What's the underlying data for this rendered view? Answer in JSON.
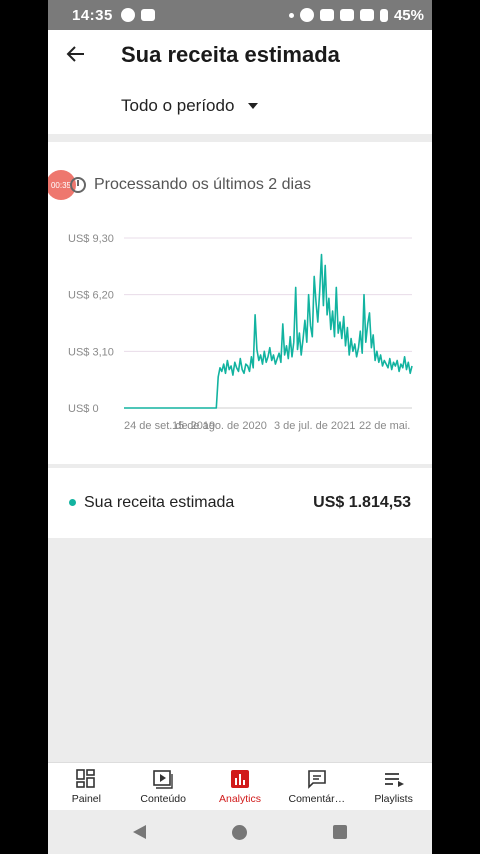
{
  "status_bar": {
    "time": "14:35",
    "battery": "45%",
    "icons": [
      "messenger-icon",
      "video-icon",
      "dot-icon",
      "vibrate-icon",
      "wifi-calling-icon",
      "wifi-icon",
      "signal-icon",
      "battery-icon"
    ]
  },
  "header": {
    "title": "Sua receita estimada",
    "period": "Todo o período"
  },
  "processing": {
    "text": "Processando os últimos 2 dias",
    "touch_indicator": "00:35"
  },
  "chart_data": {
    "type": "line",
    "y_ticks": [
      "US$ 9,30",
      "US$ 6,20",
      "US$ 3,10",
      "US$ 0"
    ],
    "ylim": [
      0,
      9.3
    ],
    "x_ticks": [
      "24 de set. de 2019",
      "15 de ago. de 2020",
      "3 de jul. de 2021",
      "22 de mai."
    ],
    "series": [
      {
        "name": "Sua receita estimada",
        "color": "#12b3a0",
        "values": [
          0,
          0,
          0,
          0,
          0,
          0,
          0,
          0,
          0,
          0,
          0,
          0,
          0,
          0,
          0,
          0,
          0,
          0,
          0,
          0,
          0,
          0,
          0,
          0,
          0,
          0,
          0,
          0,
          0,
          0,
          0,
          0,
          0,
          0,
          0,
          0,
          0,
          0,
          0,
          0,
          0,
          0,
          0,
          0,
          0,
          0,
          0,
          0,
          0,
          0,
          0,
          1.7,
          2.2,
          2.0,
          2.4,
          1.9,
          2.6,
          2.1,
          2.3,
          1.8,
          2.5,
          2.2,
          2.0,
          2.7,
          2.1,
          1.9,
          2.4,
          2.3,
          2.0,
          2.8,
          2.2,
          5.1,
          3.2,
          2.6,
          2.9,
          2.4,
          3.1,
          2.5,
          2.8,
          3.3,
          2.6,
          2.9,
          2.4,
          2.7,
          3.0,
          2.5,
          4.6,
          2.9,
          3.4,
          2.7,
          3.9,
          2.8,
          3.6,
          6.6,
          3.2,
          4.1,
          2.9,
          3.8,
          4.8,
          3.6,
          6.2,
          4.5,
          3.9,
          7.2,
          5.8,
          4.7,
          6.4,
          8.4,
          5.6,
          7.8,
          5.1,
          6.0,
          4.3,
          5.3,
          3.9,
          6.6,
          4.1,
          4.7,
          3.8,
          5.0,
          3.4,
          4.4,
          2.9,
          3.8,
          3.1,
          3.5,
          2.8,
          3.3,
          4.2,
          3.0,
          6.2,
          3.6,
          4.6,
          5.2,
          3.3,
          4.0,
          2.6,
          3.1,
          2.5,
          2.9,
          2.3,
          2.6,
          2.4,
          2.2,
          2.7,
          2.1,
          2.5,
          2.3,
          2.6,
          2.0,
          2.4,
          2.2,
          2.8,
          2.1,
          2.5,
          1.9,
          2.3
        ]
      }
    ],
    "grid": true
  },
  "legend": {
    "label": "Sua receita estimada",
    "value": "US$ 1.814,53",
    "color": "#12b3a0"
  },
  "bottom_nav": {
    "items": [
      {
        "label": "Painel",
        "icon": "dashboard-icon"
      },
      {
        "label": "Conteúdo",
        "icon": "content-icon"
      },
      {
        "label": "Analytics",
        "icon": "analytics-icon"
      },
      {
        "label": "Comentár…",
        "icon": "comments-icon"
      },
      {
        "label": "Playlists",
        "icon": "playlists-icon"
      }
    ],
    "active_color": "#d11a1a"
  }
}
